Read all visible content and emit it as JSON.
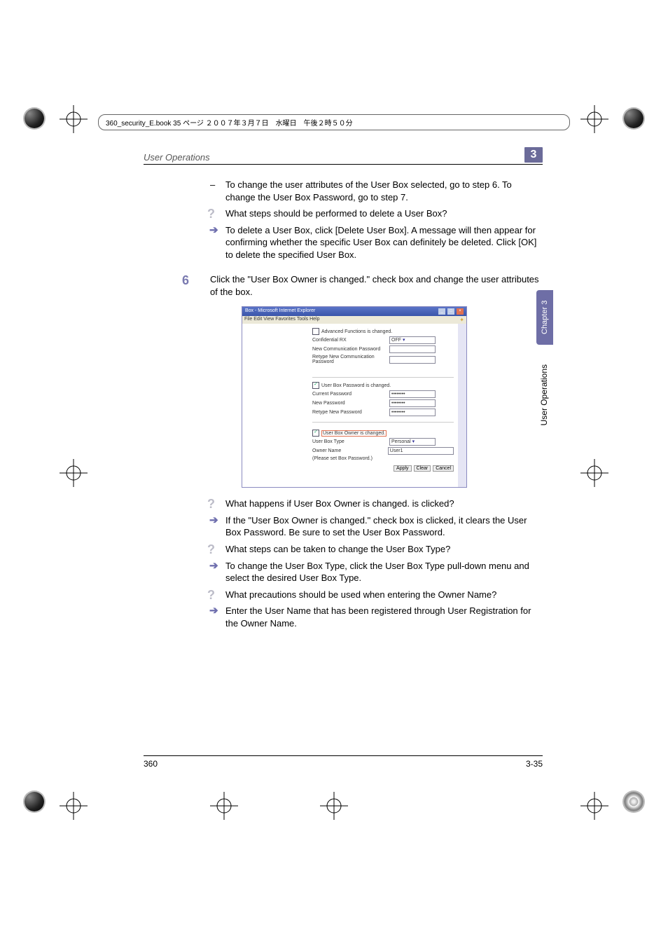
{
  "book_header": "360_security_E.book  35 ページ  ２００７年３月７日　水曜日　午後２時５０分",
  "running_title": "User Operations",
  "chapter_num": "3",
  "dash1": "To change the user attributes of the User Box selected, go to step 6. To change the User Box Password, go to step 7.",
  "q1": "What steps should be performed to delete a User Box?",
  "a1": "To delete a User Box, click [Delete User Box]. A message will then appear for confirming whether the specific User Box can definitely be deleted. Click [OK] to delete the specified User Box.",
  "step6_num": "6",
  "step6": "Click the \"User Box Owner is changed.\" check box and change the user attributes of the box.",
  "q2": "What happens if User Box Owner is changed. is clicked?",
  "a2": "If the \"User Box Owner is changed.\" check box is clicked, it clears the User Box Password. Be sure to set the User Box Password.",
  "q3": "What steps can be taken to change the User Box Type?",
  "a3": "To change the User Box Type, click the User Box Type pull-down menu and select the desired User Box Type.",
  "q4": "What precautions should be used when entering the Owner Name?",
  "a4": "Enter the User Name that has been registered through User Registration for the Owner Name.",
  "side_tab": "Chapter 3",
  "side_label": "User Operations",
  "footer_left": "360",
  "footer_right": "3-35",
  "screenshot": {
    "title": "Box - Microsoft Internet Explorer",
    "menu": "File   Edit   View   Favorites   Tools   Help",
    "groups": {
      "g1": {
        "chk": "Advanced Functions is changed.",
        "r1": {
          "lbl": "Confidential RX",
          "val": "OFF"
        },
        "r2": {
          "lbl": "New Communication Password",
          "val": ""
        },
        "r3": {
          "lbl": "Retype New Communication Password",
          "val": ""
        }
      },
      "g2": {
        "chk": "User Box Password is changed.",
        "r1": {
          "lbl": "Current Password",
          "val": "••••••••"
        },
        "r2": {
          "lbl": "New Password",
          "val": "••••••••"
        },
        "r3": {
          "lbl": "Retype New Password",
          "val": "••••••••"
        }
      },
      "g3": {
        "chk": "User Box Owner is changed.",
        "r1": {
          "lbl": "User Box Type",
          "val": "Personal"
        },
        "r2": {
          "lbl": "Owner Name",
          "val": "User1"
        },
        "r3": {
          "lbl": "(Please set Box Password.)",
          "val": ""
        }
      }
    },
    "buttons": {
      "b1": "Apply",
      "b2": "Clear",
      "b3": "Cancel"
    }
  }
}
